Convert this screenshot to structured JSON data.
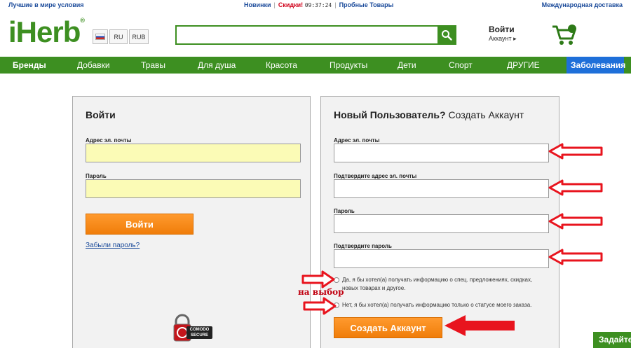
{
  "topbar": {
    "promo": "Лучшие в мире условия",
    "new": "Новинки",
    "sale": "Скидки!",
    "timer": "09:37:24",
    "trial": "Пробные Товары",
    "shipping": "Международная доставка"
  },
  "header": {
    "logo": "iHerb",
    "logo_mark": "®",
    "lang": "RU",
    "currency": "RUB",
    "search_value": "",
    "account_title": "Войти",
    "account_sub": "Аккаунт ▸"
  },
  "nav": {
    "items": [
      "Бренды",
      "Добавки",
      "Травы",
      "Для душа",
      "Красота",
      "Продукты",
      "Дети",
      "Спорт",
      "ДРУГИЕ",
      "Заболевания"
    ]
  },
  "login": {
    "title": "Войти",
    "email_label": "Адрес эл. почты",
    "password_label": "Пароль",
    "submit": "Войти",
    "forgot": "Забыли пароль?"
  },
  "register": {
    "title_bold": "Новый Пользователь?",
    "title_rest": "Создать Аккаунт",
    "email_label": "Адрес эл. почты",
    "email_confirm_label": "Подтвердите адрес эл. почты",
    "password_label": "Пароль",
    "password_confirm_label": "Подтвердите пароль",
    "opt_in": "Да, я бы хотел(а) получать информацию о спец. предложениях, скидках, новых товарах и другое.",
    "opt_out": "Нет, я бы хотел(а) получать информацию только о статусе моего заказа.",
    "submit": "Создать Аккаунт"
  },
  "annotation": {
    "note": "на выбор"
  },
  "secure_badge": {
    "line1": "COMODO",
    "line2": "SECURE"
  },
  "feedback_tab": "Задайте",
  "colors": {
    "brand_green": "#3d8f21",
    "accent_orange": "#f07d0a",
    "highlight_blue": "#1e6fd9",
    "arrow_red": "#e8141e",
    "field_yellow": "#fbfbb6"
  }
}
